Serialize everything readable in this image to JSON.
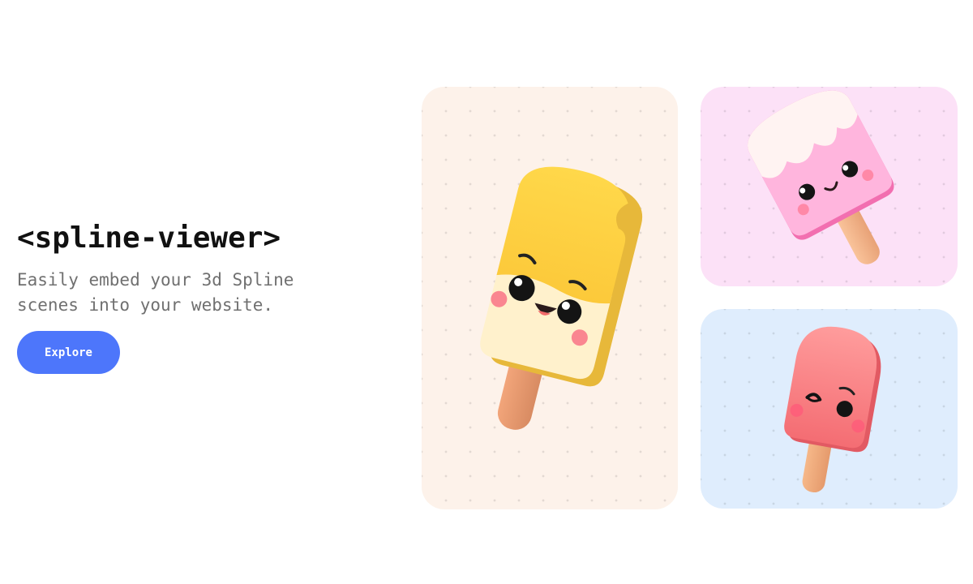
{
  "hero": {
    "title": "<spline-viewer>",
    "subtitle": "Easily embed your 3d Spline scenes into your website.",
    "button_label": "Explore"
  },
  "colors": {
    "accent": "#4d76fb",
    "card_yellow_bg": "#fdf2ea",
    "card_pink_bg": "#fce1f7",
    "card_blue_bg": "#dfedfd"
  },
  "cards": [
    {
      "icon": "yellow-popsicle-icon"
    },
    {
      "icon": "pink-popsicle-icon"
    },
    {
      "icon": "red-popsicle-icon"
    }
  ]
}
